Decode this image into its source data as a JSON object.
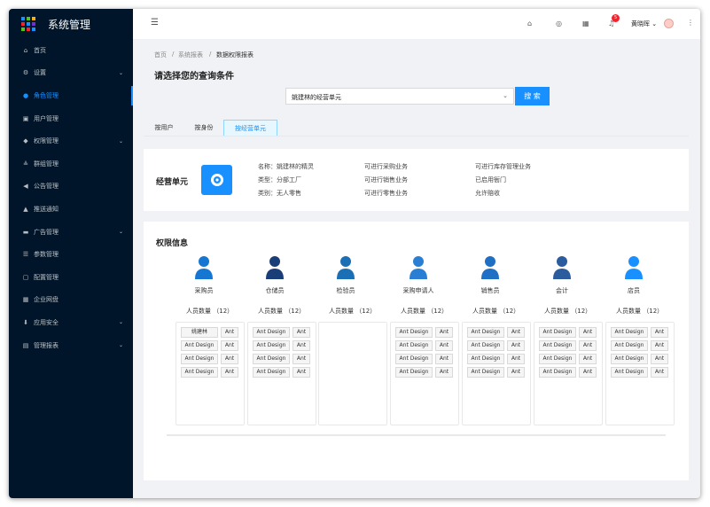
{
  "app": {
    "title": "系统管理"
  },
  "sidebar": {
    "items": [
      {
        "label": "首页",
        "icon": "home-icon",
        "glyph": "⌂"
      },
      {
        "label": "设置",
        "icon": "gear-icon",
        "glyph": "⚙",
        "expandable": true
      },
      {
        "label": "角色管理",
        "icon": "user-circle-icon",
        "glyph": "●",
        "active": true
      },
      {
        "label": "用户管理",
        "icon": "user-card-icon",
        "glyph": "▣"
      },
      {
        "label": "权限管理",
        "icon": "shield-icon",
        "glyph": "◆",
        "expandable": true
      },
      {
        "label": "群组管理",
        "icon": "team-icon",
        "glyph": "≗"
      },
      {
        "label": "公告管理",
        "icon": "megaphone-icon",
        "glyph": "◀"
      },
      {
        "label": "推送通知",
        "icon": "bell-icon",
        "glyph": "▲"
      },
      {
        "label": "广告管理",
        "icon": "picture-icon",
        "glyph": "▬",
        "expandable": true
      },
      {
        "label": "参数管理",
        "icon": "list-icon",
        "glyph": "☰"
      },
      {
        "label": "配置管理",
        "icon": "config-icon",
        "glyph": "▢"
      },
      {
        "label": "企业网盘",
        "icon": "grid-icon",
        "glyph": "▦"
      },
      {
        "label": "应用安全",
        "icon": "lock-icon",
        "glyph": "⬇",
        "expandable": true
      },
      {
        "label": "管理报表",
        "icon": "report-icon",
        "glyph": "▤",
        "expandable": true
      }
    ]
  },
  "header": {
    "notifications": "5",
    "user": "黄晓晖"
  },
  "breadcrumb": [
    "首页",
    "系统报表",
    "数据权限报表"
  ],
  "page": {
    "title": "请选择您的查询条件"
  },
  "query": {
    "select_value": "姚建林的经营单元",
    "search_label": "搜 索"
  },
  "tabs": [
    "按用户",
    "按身份",
    "按经营单元"
  ],
  "unit": {
    "title": "经营单元",
    "info": [
      [
        "名称：姚建林的精灵",
        "可进行采购业务",
        "可进行库存管理业务"
      ],
      [
        "类型：分部工厂",
        "可进行销售业务",
        "已启用衙门"
      ],
      [
        "类别：无人零售",
        "可进行零售业务",
        "允许赔收"
      ]
    ]
  },
  "permissions": {
    "title": "权限信息",
    "count_label": "人员数量",
    "count": "（12）",
    "roles": [
      "采购员",
      "仓储员",
      "检验员",
      "采购申请人",
      "销售员",
      "会计",
      "店员"
    ],
    "columns": [
      [
        [
          "姚建林",
          "Ant"
        ],
        [
          "Ant Design",
          "Ant"
        ],
        [
          "Ant Design",
          "Ant"
        ],
        [
          "Ant Design",
          "Ant"
        ]
      ],
      [
        [
          "Ant Design",
          "Ant"
        ],
        [
          "Ant Design",
          "Ant"
        ],
        [
          "Ant Design",
          "Ant"
        ],
        [
          "Ant Design",
          "Ant"
        ]
      ],
      [],
      [
        [
          "Ant Design",
          "Ant"
        ],
        [
          "Ant Design",
          "Ant"
        ],
        [
          "Ant Design",
          "Ant"
        ],
        [
          "Ant Design",
          "Ant"
        ]
      ],
      [
        [
          "Ant Design",
          "Ant"
        ],
        [
          "Ant Design",
          "Ant"
        ],
        [
          "Ant Design",
          "Ant"
        ],
        [
          "Ant Design",
          "Ant"
        ]
      ],
      [
        [
          "Ant Design",
          "Ant"
        ],
        [
          "Ant Design",
          "Ant"
        ],
        [
          "Ant Design",
          "Ant"
        ],
        [
          "Ant Design",
          "Ant"
        ]
      ],
      [
        [
          "Ant Design",
          "Ant"
        ],
        [
          "Ant Design",
          "Ant"
        ],
        [
          "Ant Design",
          "Ant"
        ],
        [
          "Ant Design",
          "Ant"
        ]
      ]
    ]
  },
  "colors": {
    "primary": "#1890ff",
    "sider": "#001529"
  }
}
